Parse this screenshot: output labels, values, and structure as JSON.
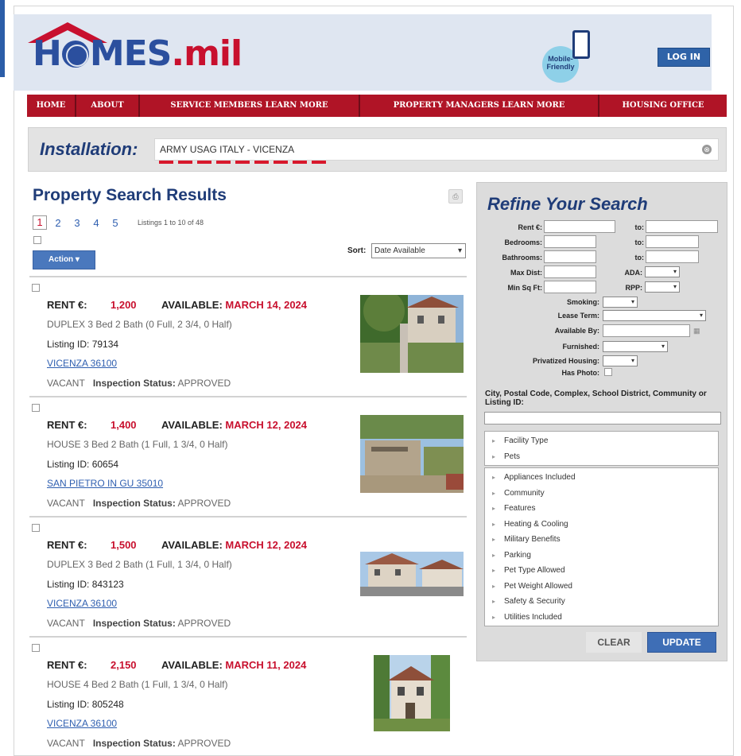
{
  "header": {
    "logo_text": "HOMES.mil",
    "mobile_badge": "Mobile-Friendly",
    "login_label": "LOG IN"
  },
  "nav": {
    "items": [
      {
        "label": "HOME"
      },
      {
        "label": "ABOUT"
      },
      {
        "label": "SERVICE MEMBERS LEARN MORE"
      },
      {
        "label": "PROPERTY MANAGERS LEARN MORE"
      },
      {
        "label": "HOUSING OFFICE"
      }
    ]
  },
  "installation": {
    "label": "Installation:",
    "value": "ARMY USAG ITALY - VICENZA",
    "clear_icon": "⊗"
  },
  "results": {
    "title": "Property Search Results",
    "pages": [
      "1",
      "2",
      "3",
      "4",
      "5"
    ],
    "current_page": "1",
    "listing_count": "Listings 1 to 10 of 48",
    "action_label": "Action ▾",
    "sort_label": "Sort:",
    "sort_value": "Date Available",
    "listings": [
      {
        "rent_label": "RENT €:",
        "rent": "1,200",
        "available_label": "AVAILABLE:",
        "available_date": "MARCH 14, 2024",
        "type_line": "DUPLEX  3 Bed  2 Bath (0 Full, 2 3/4, 0 Half)",
        "listing_id": "Listing ID: 79134",
        "city": "VICENZA 36100",
        "vacancy": "VACANT",
        "inspection_label": "Inspection Status:",
        "inspection_status": "APPROVED"
      },
      {
        "rent_label": "RENT €:",
        "rent": "1,400",
        "available_label": "AVAILABLE:",
        "available_date": "MARCH 12, 2024",
        "type_line": "HOUSE  3 Bed  2 Bath (1 Full, 1 3/4, 0 Half)",
        "listing_id": "Listing ID: 60654",
        "city": "SAN PIETRO IN GU 35010",
        "vacancy": "VACANT",
        "inspection_label": "Inspection Status:",
        "inspection_status": "APPROVED"
      },
      {
        "rent_label": "RENT €:",
        "rent": "1,500",
        "available_label": "AVAILABLE:",
        "available_date": "MARCH 12, 2024",
        "type_line": "DUPLEX  3 Bed  2 Bath (1 Full, 1 3/4, 0 Half)",
        "listing_id": "Listing ID: 843123",
        "city": "VICENZA 36100",
        "vacancy": "VACANT",
        "inspection_label": "Inspection Status:",
        "inspection_status": "APPROVED"
      },
      {
        "rent_label": "RENT €:",
        "rent": "2,150",
        "available_label": "AVAILABLE:",
        "available_date": "MARCH 11, 2024",
        "type_line": "HOUSE  4 Bed  2 Bath (1 Full, 1 3/4, 0 Half)",
        "listing_id": "Listing ID: 805248",
        "city": "VICENZA 36100",
        "vacancy": "VACANT",
        "inspection_label": "Inspection Status:",
        "inspection_status": "APPROVED"
      }
    ]
  },
  "refine": {
    "title": "Refine Your Search",
    "rent_label": "Rent €:",
    "to_label": "to:",
    "bedrooms_label": "Bedrooms:",
    "bathrooms_label": "Bathrooms:",
    "max_dist_label": "Max Dist:",
    "ada_label": "ADA:",
    "min_sqft_label": "Min Sq Ft:",
    "rpp_label": "RPP:",
    "smoking_label": "Smoking:",
    "lease_term_label": "Lease Term:",
    "available_by_label": "Available By:",
    "furnished_label": "Furnished:",
    "privatized_label": "Privatized Housing:",
    "has_photo_label": "Has Photo:",
    "city_label": "City, Postal Code, Complex, School District, Community or Listing ID:",
    "facets_top": [
      "Facility Type",
      "Pets"
    ],
    "facets_bottom": [
      "Appliances Included",
      "Community",
      "Features",
      "Heating & Cooling",
      "Military Benefits",
      "Parking",
      "Pet Type Allowed",
      "Pet Weight Allowed",
      "Safety & Security",
      "Utilities Included"
    ],
    "clear_label": "CLEAR",
    "update_label": "UPDATE"
  },
  "colors": {
    "brand_blue": "#1f3c78",
    "brand_red": "#b01426",
    "link_blue": "#2f5fb0",
    "accent_red": "#c8102e"
  }
}
